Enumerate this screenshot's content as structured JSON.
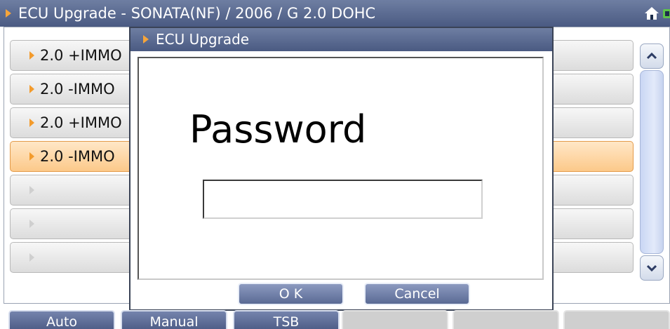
{
  "header": {
    "title": "ECU Upgrade - SONATA(NF) / 2006 / G 2.0 DOHC",
    "icons": [
      "home-icon",
      "connection-icon"
    ]
  },
  "list": {
    "items": [
      {
        "label": "2.0 +IMMO",
        "selected": false
      },
      {
        "label": "2.0 -IMMO",
        "selected": false
      },
      {
        "label": "2.0 +IMMO",
        "selected": false
      },
      {
        "label": "2.0 -IMMO",
        "selected": true
      },
      {
        "label": "",
        "selected": false
      },
      {
        "label": "",
        "selected": false
      },
      {
        "label": "",
        "selected": false
      }
    ]
  },
  "scrollbar": {
    "up_icon": "chevron-up-icon",
    "down_icon": "chevron-down-icon"
  },
  "dialog": {
    "title": "ECU Upgrade",
    "prompt": "Password",
    "input_value": "",
    "ok_label": "O K",
    "cancel_label": "Cancel"
  },
  "tabs": [
    {
      "label": "Auto",
      "enabled": true
    },
    {
      "label": "Manual",
      "enabled": true
    },
    {
      "label": "TSB",
      "enabled": true
    },
    {
      "label": "",
      "enabled": false
    },
    {
      "label": "",
      "enabled": false
    },
    {
      "label": "",
      "enabled": false
    }
  ],
  "colors": {
    "titlebar": "#5a6a92",
    "accent_arrow": "#f39b2c",
    "selected_item": "#fcc98a",
    "button": "#5a6a94"
  }
}
